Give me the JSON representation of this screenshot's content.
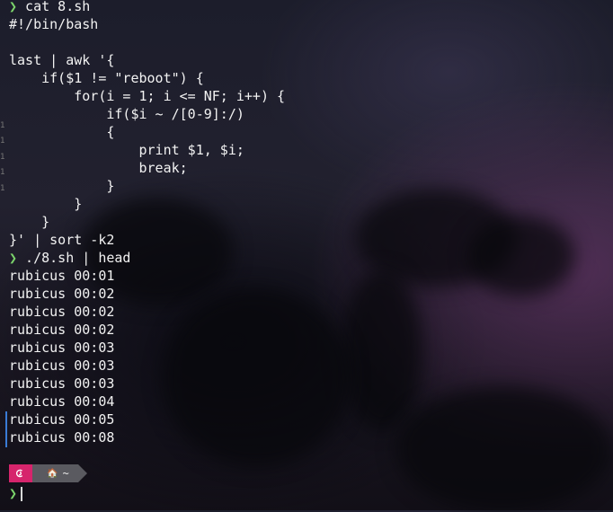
{
  "terminal": {
    "prompt_symbol": "❯",
    "lines": [
      {
        "prompt": true,
        "text": " cat 8.sh"
      },
      {
        "prompt": false,
        "text": "#!/bin/bash"
      },
      {
        "prompt": false,
        "text": ""
      },
      {
        "prompt": false,
        "text": "last | awk '{"
      },
      {
        "prompt": false,
        "text": "    if($1 != \"reboot\") {"
      },
      {
        "prompt": false,
        "text": "        for(i = 1; i <= NF; i++) {"
      },
      {
        "prompt": false,
        "text": "            if($i ~ /[0-9]:/)"
      },
      {
        "prompt": false,
        "text": "            {"
      },
      {
        "prompt": false,
        "text": "                print $1, $i;"
      },
      {
        "prompt": false,
        "text": "                break;"
      },
      {
        "prompt": false,
        "text": "            }"
      },
      {
        "prompt": false,
        "text": "        }"
      },
      {
        "prompt": false,
        "text": "    }"
      },
      {
        "prompt": false,
        "text": "}' | sort -k2"
      },
      {
        "prompt": true,
        "text": " ./8.sh | head"
      },
      {
        "prompt": false,
        "text": "rubicus 00:01"
      },
      {
        "prompt": false,
        "text": "rubicus 00:02"
      },
      {
        "prompt": false,
        "text": "rubicus 00:02"
      },
      {
        "prompt": false,
        "text": "rubicus 00:02"
      },
      {
        "prompt": false,
        "text": "rubicus 00:03"
      },
      {
        "prompt": false,
        "text": "rubicus 00:03"
      },
      {
        "prompt": false,
        "text": "rubicus 00:03"
      },
      {
        "prompt": false,
        "text": "rubicus 00:04"
      },
      {
        "prompt": false,
        "text": "rubicus 00:05"
      },
      {
        "prompt": false,
        "text": "rubicus 00:08"
      }
    ],
    "gutter_marks": [
      "1",
      "1",
      "1",
      "1",
      "1"
    ],
    "powerline": {
      "os_icon": "debian-swirl-icon",
      "home_icon": "🏠",
      "dir": "~"
    },
    "input": ""
  },
  "colors": {
    "prompt": "#7bd36b",
    "os_segment": "#d6256c",
    "dir_segment": "#5a5a60"
  }
}
